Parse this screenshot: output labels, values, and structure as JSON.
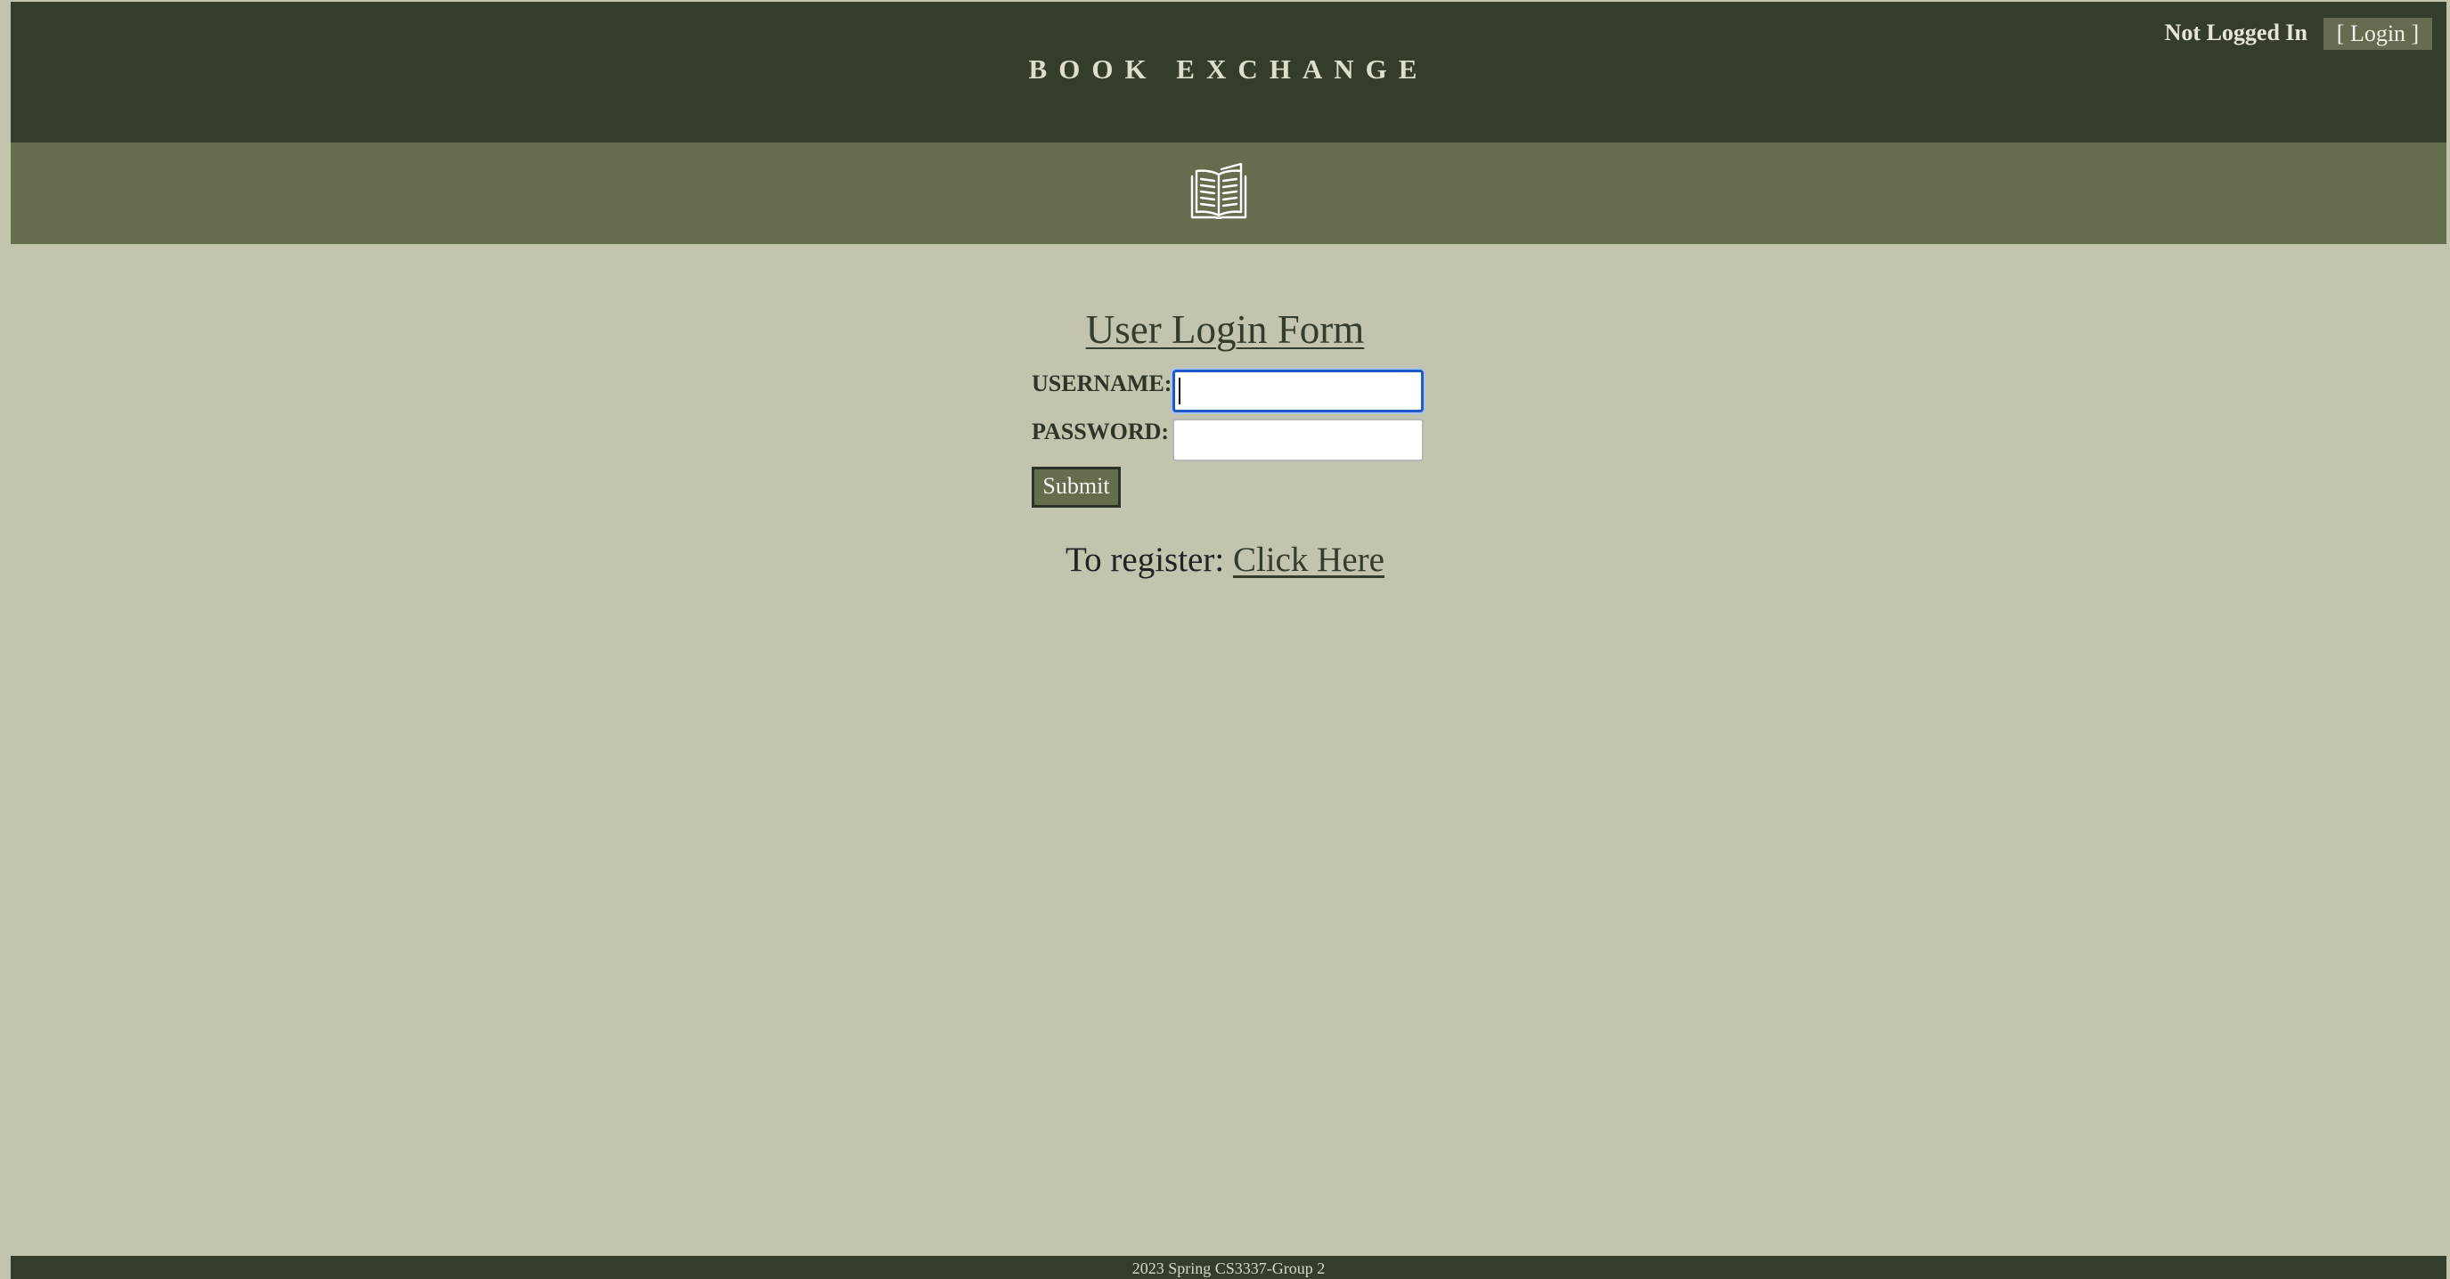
{
  "header": {
    "title": "BOOK EXCHANGE",
    "status": "Not Logged In",
    "login_label": "[ Login ]"
  },
  "banner": {
    "icon": "open-book-icon"
  },
  "form": {
    "title": "User Login Form",
    "username_label": "USERNAME:",
    "username_value": "",
    "password_label": "PASSWORD:",
    "password_value": "",
    "submit_label": "Submit"
  },
  "register": {
    "prefix": "To register:",
    "link_label": "Click Here"
  },
  "footer": {
    "text": "2023 Spring CS3337-Group 2"
  },
  "colors": {
    "header_bg": "#343d2c",
    "banner_bg": "#656d4f",
    "page_bg": "#c2c4ae",
    "focus_ring": "#1f5bc8"
  }
}
